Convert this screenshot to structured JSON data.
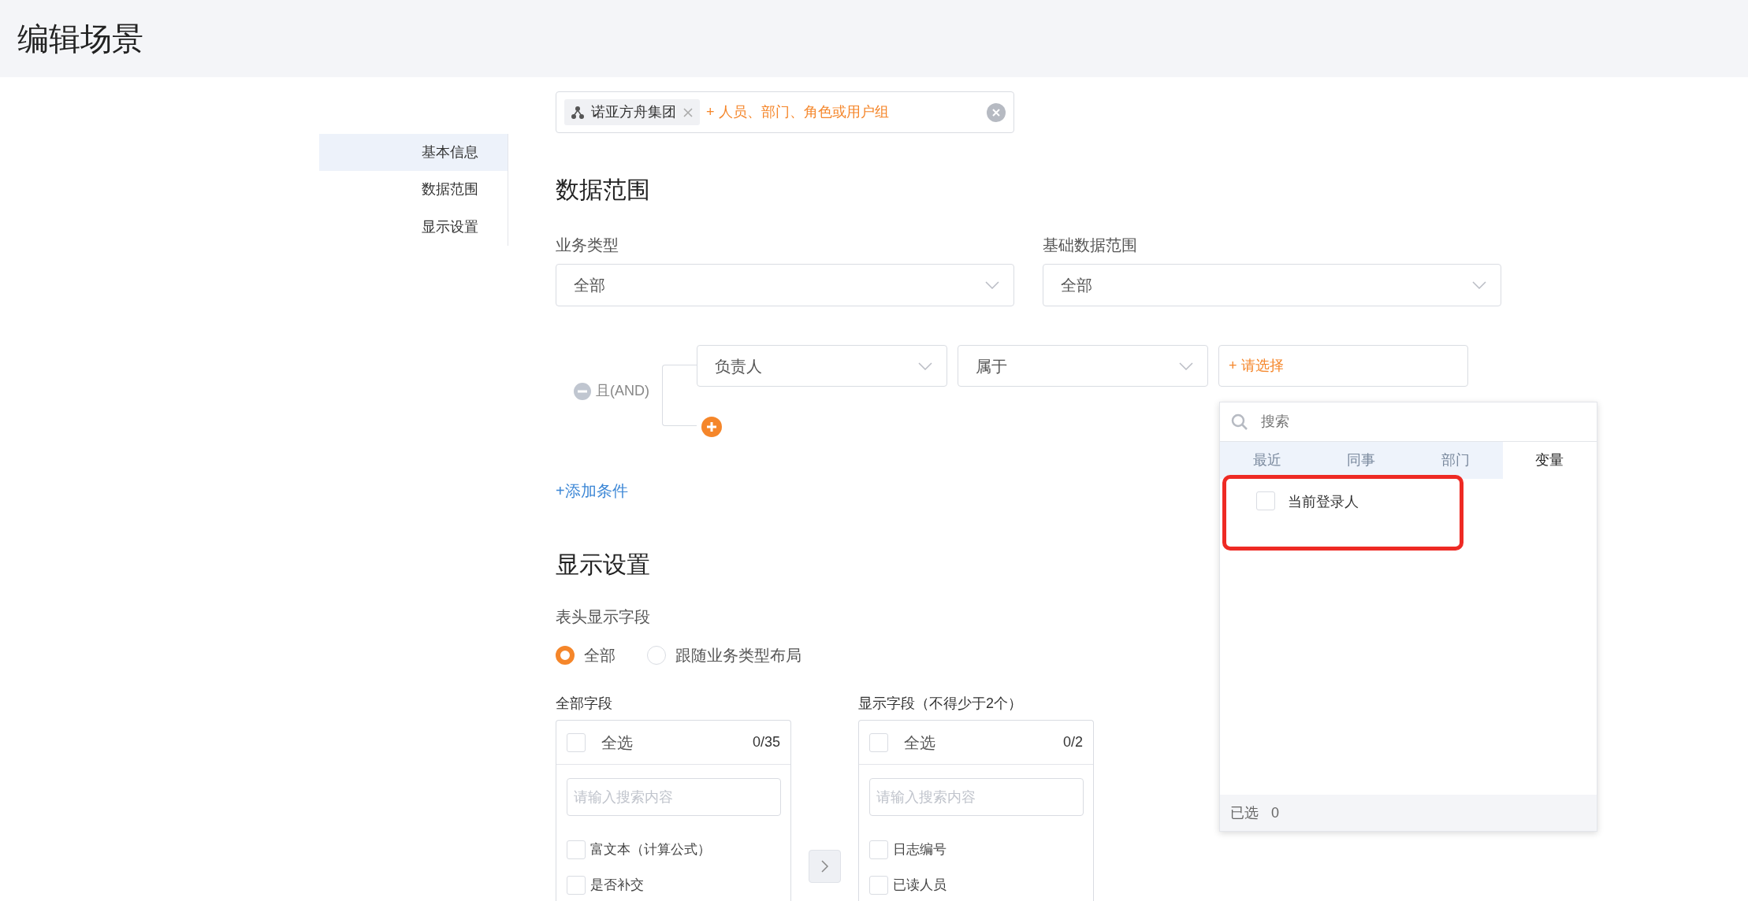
{
  "header": {
    "title": "编辑场景"
  },
  "sidebar": {
    "items": [
      {
        "label": "基本信息",
        "selected": true
      },
      {
        "label": "数据范围",
        "selected": false
      },
      {
        "label": "显示设置",
        "selected": false
      }
    ]
  },
  "scope": {
    "tags": [
      {
        "label": "诺亚方舟集团"
      }
    ],
    "add_hint": "+ 人员、部门、角色或用户组"
  },
  "data_scope": {
    "heading": "数据范围",
    "fields": [
      {
        "label": "业务类型",
        "value": "全部"
      },
      {
        "label": "基础数据范围",
        "value": "全部"
      }
    ],
    "condition": {
      "logic": "且(AND)",
      "rows": [
        {
          "field": "负责人",
          "operator": "属于",
          "value_placeholder": "+ 请选择"
        }
      ]
    },
    "add_condition": "+添加条件"
  },
  "picker": {
    "search_placeholder": "搜索",
    "tabs": [
      {
        "label": "最近",
        "selected": false
      },
      {
        "label": "同事",
        "selected": false
      },
      {
        "label": "部门",
        "selected": false
      },
      {
        "label": "变量",
        "selected": true
      }
    ],
    "items": [
      {
        "label": "当前登录人",
        "checked": false,
        "highlighted": true
      }
    ],
    "footer_label": "已选",
    "footer_count": "0"
  },
  "display": {
    "heading": "显示设置",
    "label": "表头显示字段",
    "radios": [
      {
        "label": "全部",
        "selected": true
      },
      {
        "label": "跟随业务类型布局",
        "selected": false
      }
    ],
    "lists": [
      {
        "title": "全部字段",
        "select_all": "全选",
        "checked": false,
        "count": "0/35",
        "search_placeholder": "请输入搜索内容",
        "items": [
          {
            "label": "富文本（计算公式）",
            "checked": false
          },
          {
            "label": "是否补交",
            "checked": false
          }
        ]
      },
      {
        "title": "显示字段（不得少于2个）",
        "select_all": "全选",
        "checked": false,
        "count": "0/2",
        "search_placeholder": "请输入搜索内容",
        "items": [
          {
            "label": "日志编号",
            "checked": false
          },
          {
            "label": "已读人员",
            "checked": false
          }
        ]
      }
    ]
  }
}
